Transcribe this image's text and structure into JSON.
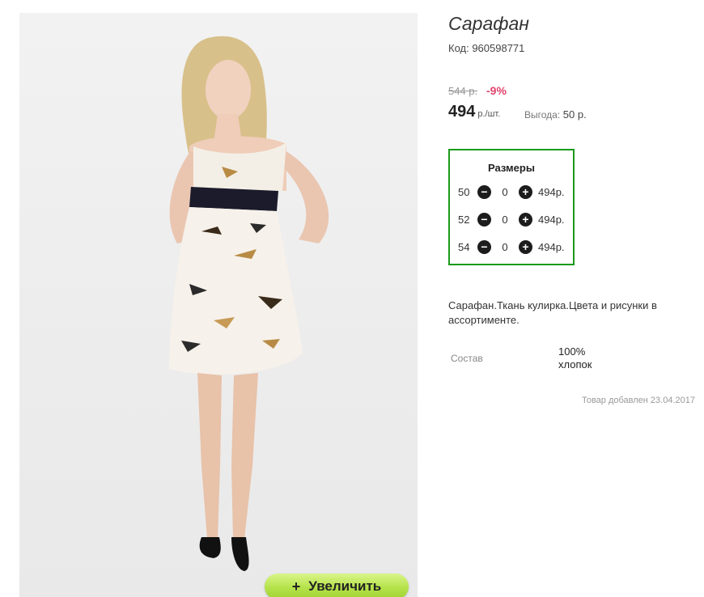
{
  "product": {
    "title": "Сарафан",
    "code": "Код: 960598771",
    "old_price": "544 р.",
    "discount": "-9%",
    "price": "494",
    "price_unit": "р./шт.",
    "benefit_label": "Выгода:",
    "benefit_value": "50 р.",
    "zoom_label": "Увеличить",
    "zoom_plus": "+"
  },
  "sizes": {
    "title": "Размеры",
    "rows": [
      {
        "size": "50",
        "qty": "0",
        "price": "494р."
      },
      {
        "size": "52",
        "qty": "0",
        "price": "494р."
      },
      {
        "size": "54",
        "qty": "0",
        "price": "494р."
      }
    ],
    "minus": "−",
    "plus": "+"
  },
  "description": "Сарафан.Ткань кулирка.Цвета и рисунки в ассортименте.",
  "specs": {
    "composition_label": "Состав",
    "composition_value": "100% хлопок"
  },
  "added": "Товар добавлен 23.04.2017",
  "colors": {
    "accent_green": "#1a9a1a",
    "discount_pink": "#e0436b",
    "zoom_button": "#b5e24a"
  }
}
